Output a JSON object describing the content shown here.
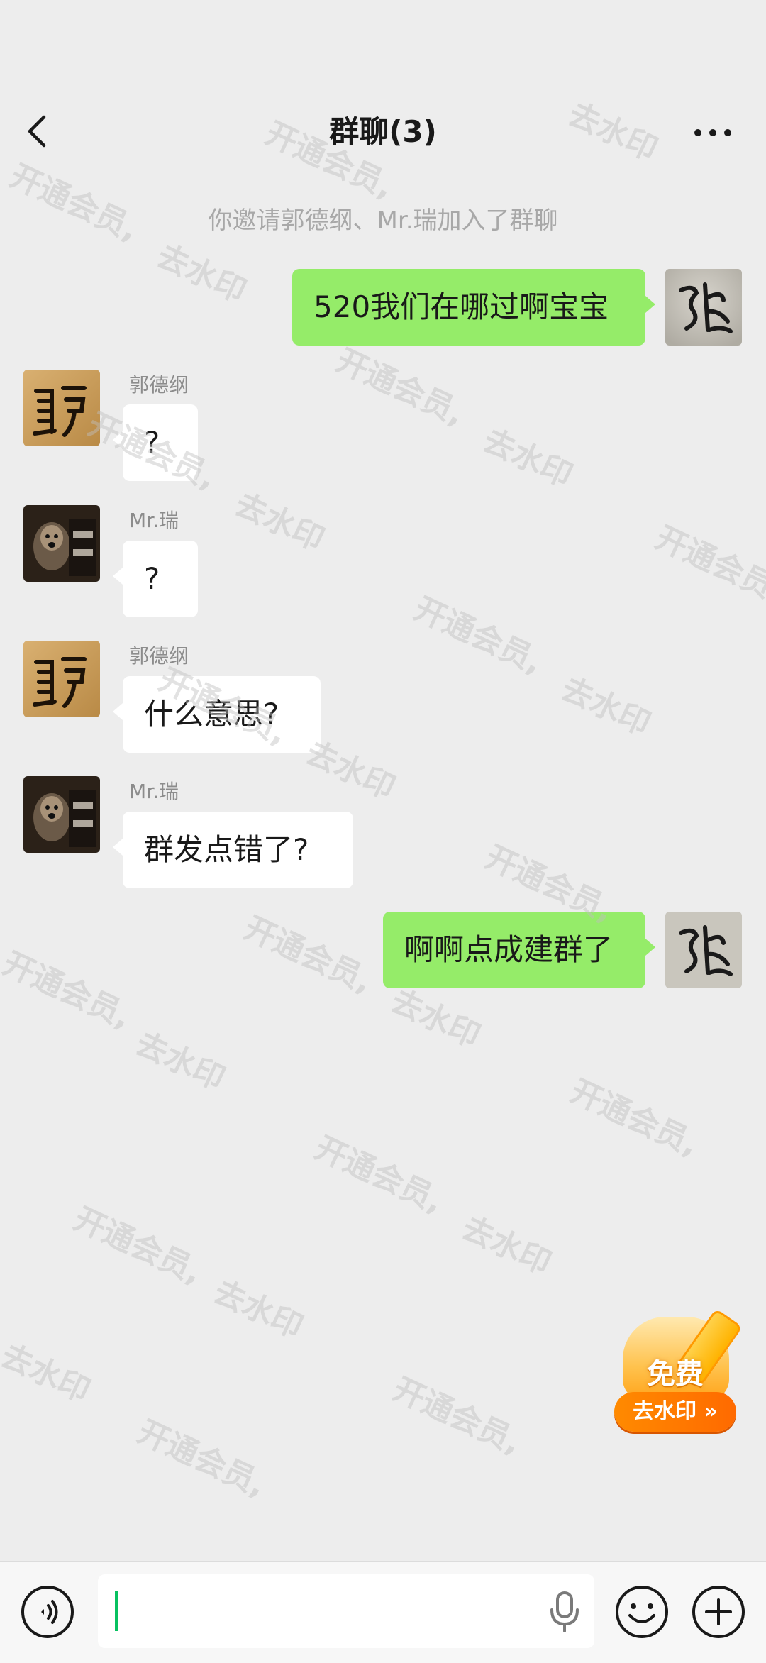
{
  "header": {
    "title": "群聊(3)"
  },
  "system_message": "你邀请郭德纲、Mr.瑞加入了群聊",
  "messages": [
    {
      "direction": "out",
      "text": "520我们在哪过啊宝宝"
    },
    {
      "direction": "in",
      "sender": "郭德纲",
      "text": "?"
    },
    {
      "direction": "in",
      "sender": "Mr.瑞",
      "text": "?"
    },
    {
      "direction": "in",
      "sender": "郭德纲",
      "text": "什么意思?"
    },
    {
      "direction": "in",
      "sender": "Mr.瑞",
      "text": "群发点错了?"
    },
    {
      "direction": "out",
      "text": "啊啊点成建群了"
    }
  ],
  "watermark": {
    "text_a": "开通会员,",
    "text_b": "去水印"
  },
  "promo": {
    "top_label": "免费",
    "bottom_label": "去水印 »"
  },
  "input": {
    "value": ""
  },
  "icons": {
    "back": "chevron-left-icon",
    "more": "more-dots-icon",
    "voice": "voice-mode-icon",
    "mic": "microphone-icon",
    "emoji": "emoji-icon",
    "plus": "plus-icon"
  },
  "colors": {
    "background": "#ededed",
    "outgoing_bubble": "#95ec69",
    "incoming_bubble": "#ffffff",
    "caret": "#07c160"
  }
}
